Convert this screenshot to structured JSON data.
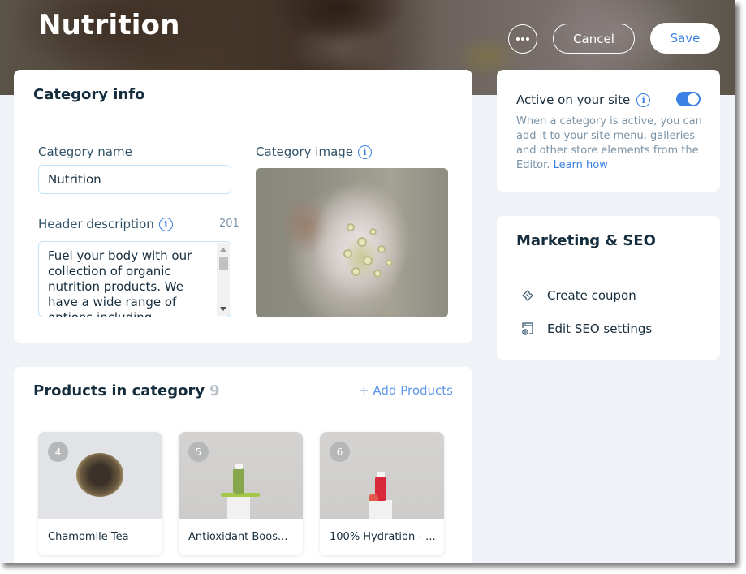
{
  "header": {
    "title": "Nutrition",
    "cancel_label": "Cancel",
    "save_label": "Save"
  },
  "category_info": {
    "section_title": "Category info",
    "name_label": "Category name",
    "name_value": "Nutrition",
    "description_label": "Header description",
    "description_char_count": "201",
    "description_value": "Fuel your body with our collection of organic nutrition products. We have a wide range of options including",
    "image_label": "Category image"
  },
  "active_panel": {
    "title": "Active on your site",
    "toggle_on": true,
    "description": "When a category is active, you can add it to your site menu, galleries and other store elements from the Editor.",
    "learn_link": "Learn how"
  },
  "marketing": {
    "title": "Marketing & SEO",
    "items": [
      {
        "label": "Create coupon",
        "icon": "coupon-icon"
      },
      {
        "label": "Edit SEO settings",
        "icon": "seo-settings-icon"
      }
    ]
  },
  "products": {
    "title": "Products in category",
    "count": "9",
    "add_label": "+ Add Products",
    "items": [
      {
        "number": "4",
        "name": "Chamomile Tea"
      },
      {
        "number": "5",
        "name": "Antioxidant Boos..."
      },
      {
        "number": "6",
        "name": "100% Hydration - ..."
      }
    ]
  },
  "colors": {
    "accent": "#3b80e3",
    "text_primary": "#162d3d",
    "text_secondary": "#7a92a5",
    "page_bg": "#eff2f6"
  }
}
